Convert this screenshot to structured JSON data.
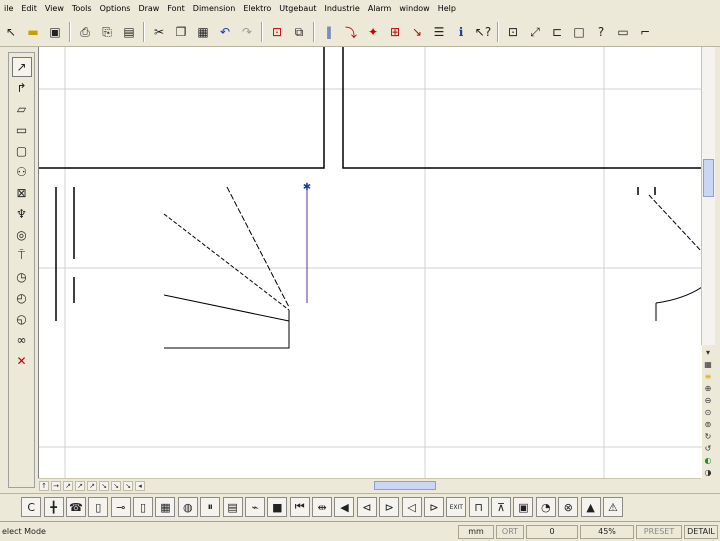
{
  "menu": [
    "ile",
    "Edit",
    "View",
    "Tools",
    "Options",
    "Draw",
    "Font",
    "Dimension",
    "Elektro",
    "Utgebaut",
    "Industrie",
    "Alarm",
    "window",
    "Help"
  ],
  "toolbar": {
    "icons": [
      "arrow-icon",
      "open-folder-icon",
      "save-icon",
      "print-icon",
      "print-preview-icon",
      "copy-page-icon",
      "cut-icon",
      "copy-icon",
      "paste-icon",
      "undo-icon",
      "redo-icon",
      "zoom-window-icon",
      "zoom-select-icon",
      "parallel-lines-icon",
      "red-arrow-icon",
      "red-node-icon",
      "red-select-box-icon",
      "pointer-icon",
      "list-icon",
      "info-icon",
      "help-pointer-icon",
      "select-frame-icon",
      "fit-icon",
      "crop-icon",
      "rectangle-icon",
      "question-icon",
      "box-icon",
      "line-icon"
    ]
  },
  "left_tools": [
    "line-tool-icon",
    "arc-tool-icon",
    "wall-tool-icon",
    "double-wall-icon",
    "rectangle-tool-icon",
    "socket-icon",
    "cross-box-icon",
    "plug-icon",
    "circle-target-icon",
    "antenna-icon",
    "timer-icon",
    "clock-icon",
    "dial-icon",
    "link-icon",
    "delete-red-x-icon"
  ],
  "right_tools": [
    "arrow-down-icon",
    "grid-icon",
    "yellow-lines-icon",
    "zoom-in-icon",
    "zoom-out-icon",
    "zoom-icon",
    "zoom-all-icon",
    "refresh-icon",
    "undo-view-icon",
    "zoom-prev-icon",
    "zoom-next-icon"
  ],
  "bottom_tools": [
    "c-tool-icon",
    "tee-icon",
    "phone-icon",
    "brackets-icon",
    "plug-tool-icon",
    "battery-icon",
    "grid-tool-icon",
    "dial-tool-icon",
    "pause-icon",
    "panel-icon",
    "graph-icon",
    "stop-icon",
    "skip-back-icon",
    "connect-icon",
    "speaker-icon",
    "speaker-left-icon",
    "speaker-right-icon",
    "speaker-loud-icon",
    "transistor-icon",
    "exit-sign-icon",
    "comb-icon",
    "bell-icon",
    "save-disk-icon",
    "clock-tool-icon",
    "x-circle-icon",
    "fire-icon",
    "alarm-icon"
  ],
  "status": {
    "mode": "elect Mode",
    "unit": "mm",
    "ortho": "ORT",
    "value": "0",
    "zoom": "45%",
    "preset": "PRESET",
    "detail": "DETAIL"
  }
}
